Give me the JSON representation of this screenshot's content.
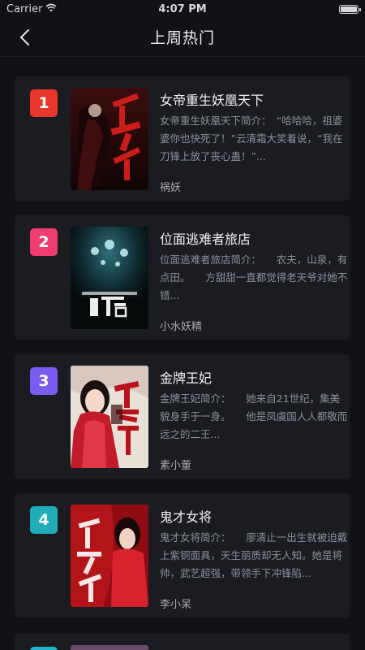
{
  "status_bar": {
    "carrier": "Carrier",
    "time": "4:07 PM"
  },
  "nav": {
    "title": "上周热门"
  },
  "books": [
    {
      "rank": "1",
      "rank_color": "#e8362c",
      "title": "女帝重生妖凰天下",
      "description": "女帝重生妖凰天下简介：　“哈哈哈，祖婆婆你也快死了！”云清霜大笑着说，“我在刀锋上放了丧心蛊！”...",
      "author": "祸妖",
      "cover_text": "妖凰天下"
    },
    {
      "rank": "2",
      "rank_color": "#ee3d6e",
      "title": "位面逃难者旅店",
      "description": "位面逃难者旅店简介：　　农夫，山泉，有点田。　　方甜甜一直都觉得老天爷对她不错...",
      "author": "小水妖精",
      "cover_text": "位面逃难者旅店"
    },
    {
      "rank": "3",
      "rank_color": "#7a5cf0",
      "title": "金牌王妃",
      "description": "金牌王妃简介：　　她来自21世纪，集美貌身手于一身。　　他是凤虞国人人都敬而远之的二王...",
      "author": "素小董",
      "cover_text": "王爷求你别撩了"
    },
    {
      "rank": "4",
      "rank_color": "#20adb8",
      "title": "鬼才女将",
      "description": "鬼才女将简介：　　廖清止一出生就被迫戴上紫铜面具，天生丽质却无人知。她是将帅，武艺超强，带领手下冲锋陷...",
      "author": "李小呆",
      "cover_text": "鬼才女将"
    }
  ]
}
